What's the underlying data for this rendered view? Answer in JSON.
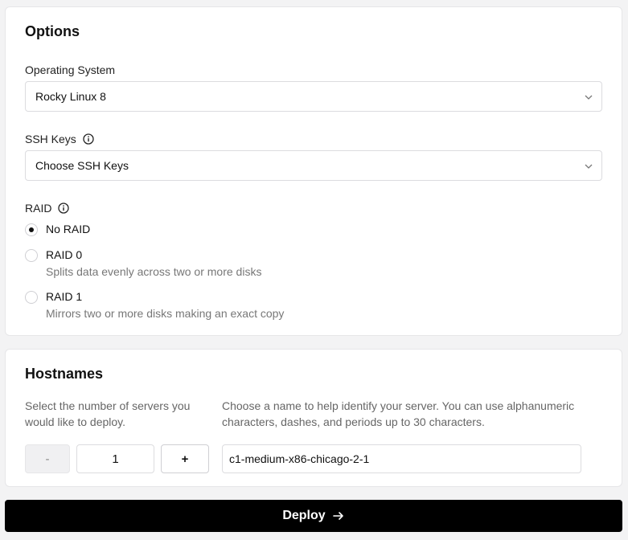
{
  "options": {
    "title": "Options",
    "os": {
      "label": "Operating System",
      "value": "Rocky Linux 8"
    },
    "ssh": {
      "label": "SSH Keys",
      "placeholder": "Choose SSH Keys"
    },
    "raid": {
      "label": "RAID",
      "items": [
        {
          "label": "No RAID",
          "description": "",
          "selected": true
        },
        {
          "label": "RAID 0",
          "description": "Splits data evenly across two or more disks",
          "selected": false
        },
        {
          "label": "RAID 1",
          "description": "Mirrors two or more disks making an exact copy",
          "selected": false
        }
      ]
    }
  },
  "hostnames": {
    "title": "Hostnames",
    "count_help": "Select the number of servers you would like to deploy.",
    "name_help": "Choose a name to help identify your server. You can use alphanumeric characters, dashes, and periods up to 30 characters.",
    "decrement_label": "-",
    "count": "1",
    "increment_label": "+",
    "hostname_value": "c1-medium-x86-chicago-2-1"
  },
  "deploy": {
    "label": "Deploy"
  }
}
